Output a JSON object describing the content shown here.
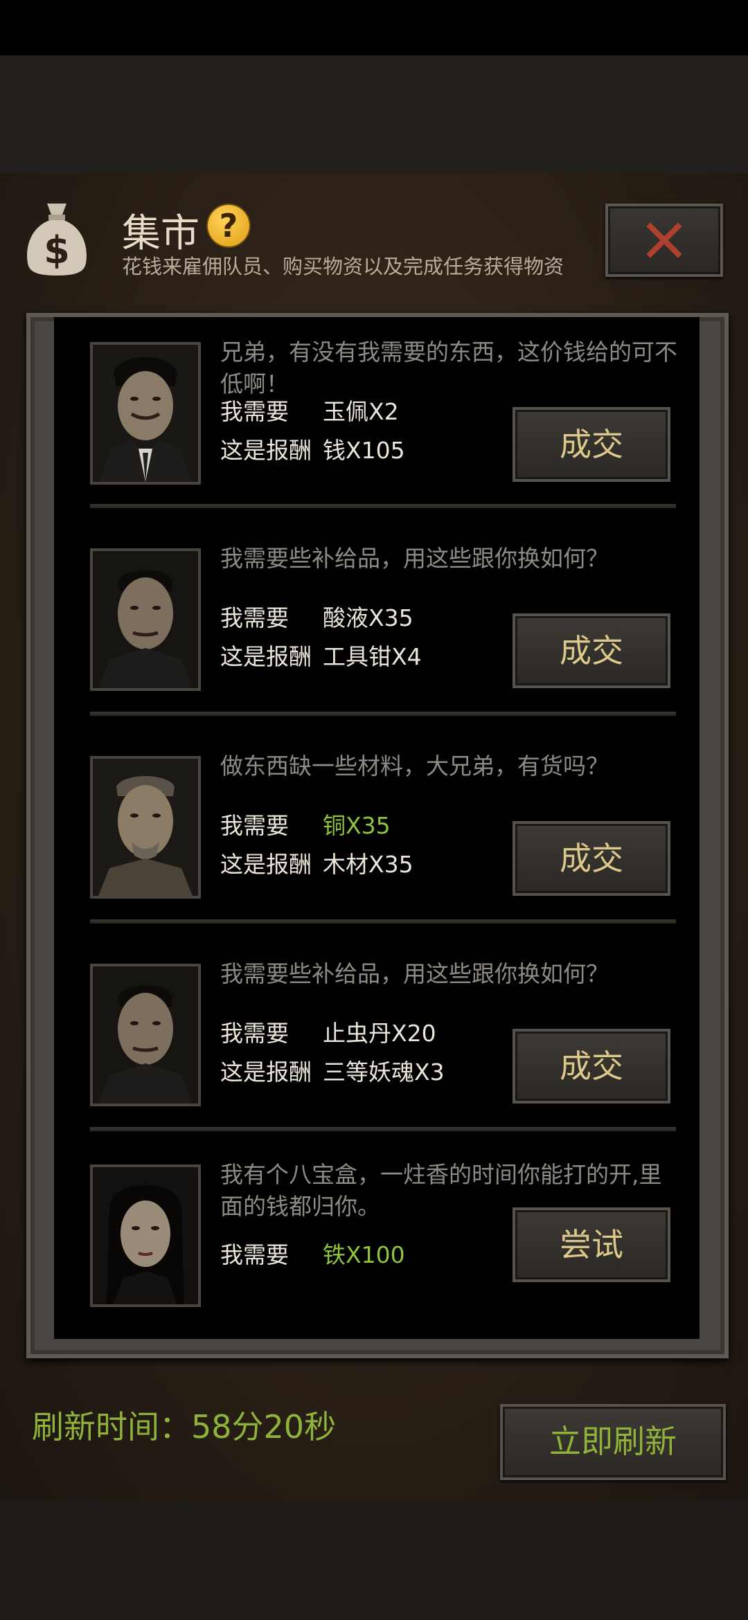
{
  "header": {
    "title": "集市",
    "help_icon": "?",
    "subtitle": "花钱来雇佣队员、购买物资以及完成任务获得物资"
  },
  "labels": {
    "need": "我需要",
    "reward": "这是报酬"
  },
  "trades": [
    {
      "dialog": "兄弟，有没有我需要的东西，这价钱给的可不低啊！",
      "need": "玉佩X2",
      "reward": "钱X105",
      "button": "成交",
      "need_highlight": false
    },
    {
      "dialog": "我需要些补给品，用这些跟你换如何？",
      "need": "酸液X35",
      "reward": "工具钳X4",
      "button": "成交",
      "need_highlight": false
    },
    {
      "dialog": "做东西缺一些材料，大兄弟，有货吗？",
      "need": "铜X35",
      "reward": "木材X35",
      "button": "成交",
      "need_highlight": true
    },
    {
      "dialog": "我需要些补给品，用这些跟你换如何？",
      "need": "止虫丹X20",
      "reward": "三等妖魂X3",
      "button": "成交",
      "need_highlight": false
    },
    {
      "dialog": "我有个八宝盒，一炷香的时间你能打的开,里面的钱都归你。",
      "need": "铁X100",
      "reward": "",
      "button": "尝试",
      "need_highlight": true
    }
  ],
  "footer": {
    "refresh_label": "刷新时间：58分20秒",
    "refresh_button": "立即刷新"
  },
  "colors": {
    "highlight_green": "#8fc43c",
    "button_text": "#dcc88a"
  }
}
